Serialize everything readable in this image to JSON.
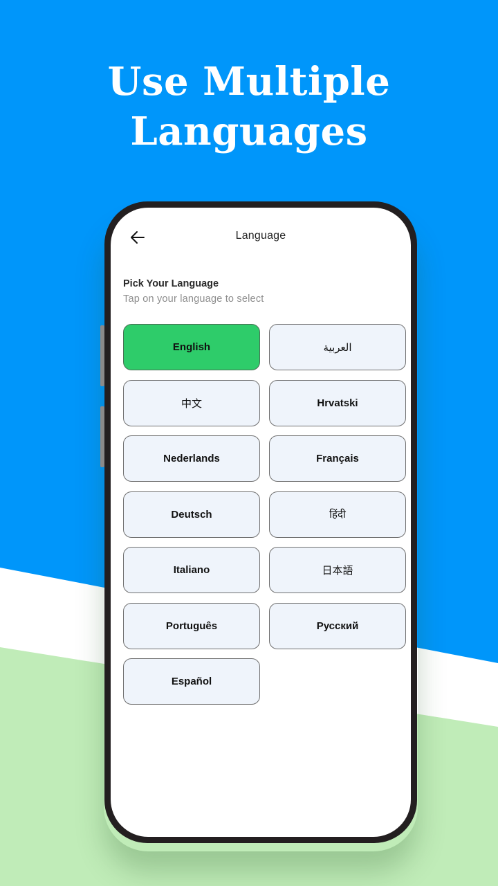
{
  "promo": {
    "headline_line1": "Use Multiple",
    "headline_line2": "Languages"
  },
  "colors": {
    "background_blue": "#0096fa",
    "wave_white": "#ffffff",
    "wave_green": "#c0ecb8",
    "selected_green": "#2ecc6a",
    "button_fill": "#eff4fb"
  },
  "appbar": {
    "back_icon": "arrow-left-icon",
    "title": "Language"
  },
  "section": {
    "title": "Pick Your Language",
    "subtitle": "Tap on your language to select"
  },
  "languages": [
    {
      "label": "English",
      "selected": true,
      "native_script": false
    },
    {
      "label": "العربية",
      "selected": false,
      "native_script": true
    },
    {
      "label": "中文",
      "selected": false,
      "native_script": true
    },
    {
      "label": "Hrvatski",
      "selected": false,
      "native_script": false
    },
    {
      "label": "Nederlands",
      "selected": false,
      "native_script": false
    },
    {
      "label": "Français",
      "selected": false,
      "native_script": false
    },
    {
      "label": "Deutsch",
      "selected": false,
      "native_script": false
    },
    {
      "label": "हिंदी",
      "selected": false,
      "native_script": true
    },
    {
      "label": "Italiano",
      "selected": false,
      "native_script": false
    },
    {
      "label": "日本語",
      "selected": false,
      "native_script": true
    },
    {
      "label": "Português",
      "selected": false,
      "native_script": false
    },
    {
      "label": "Русский",
      "selected": false,
      "native_script": false
    },
    {
      "label": "Español",
      "selected": false,
      "native_script": false
    }
  ]
}
